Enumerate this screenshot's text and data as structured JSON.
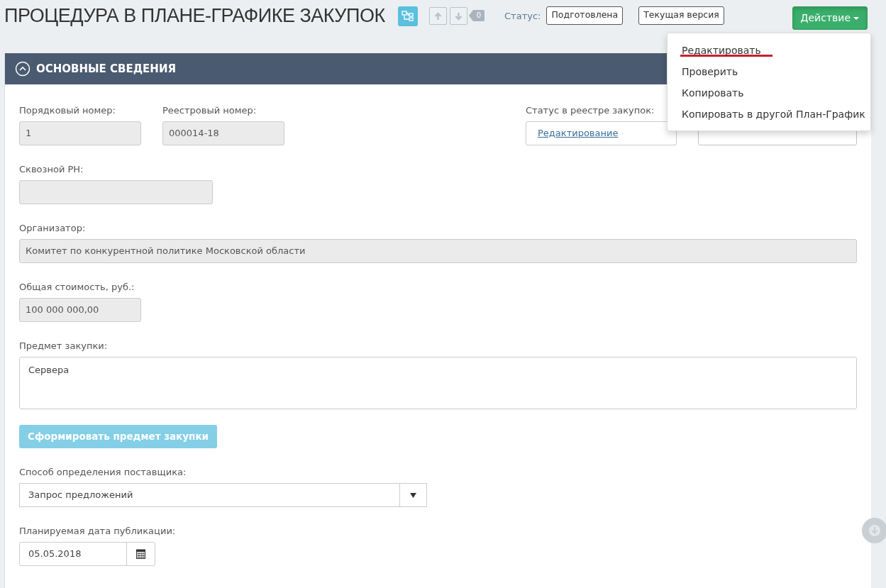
{
  "title": "ПРОЦЕДУРА В ПЛАНЕ-ГРАФИКЕ ЗАКУПОК",
  "counter": "0",
  "status_label": "Статус:",
  "status_badges": [
    "Подготовлена",
    "Текущая версия"
  ],
  "action_button": {
    "label": "Действие",
    "expanded": true
  },
  "action_menu": [
    {
      "label": "Редактировать",
      "underlined": true
    },
    {
      "label": "Проверить",
      "underlined": false
    },
    {
      "label": "Копировать",
      "underlined": false
    },
    {
      "label": "Копировать в другой План-График",
      "underlined": false
    }
  ],
  "section": {
    "title": "ОСНОВНЫЕ СВЕДЕНИЯ",
    "expanded": true
  },
  "form_rows": [
    [
      {
        "kind": "text",
        "label": "Порядковый номер:",
        "value": "1",
        "disabled": true
      },
      {
        "kind": "text",
        "label": "Реестровый номер:",
        "value": "000014-18",
        "disabled": true
      },
      {
        "kind": "spacer"
      },
      {
        "kind": "link",
        "label": "Статус в реестре закупок:",
        "value": "Редактирование"
      },
      {
        "kind": "text",
        "disabled": false
      }
    ],
    [
      {
        "kind": "text",
        "label": "Сквозной РН:",
        "disabled": true
      }
    ],
    [
      {
        "kind": "text",
        "label": "Организатор:",
        "value": "Комитет по конкурентной политике Московской области",
        "disabled": true
      }
    ],
    [
      {
        "kind": "text",
        "label": "Общая стоимость, руб.:",
        "value": "100 000 000,00",
        "disabled": true
      }
    ],
    [
      {
        "kind": "textarea",
        "label": "Предмет закупки:",
        "value": "Сервера"
      }
    ],
    [
      {
        "kind": "button",
        "value": "Сформировать предмет закупки",
        "disabled": true
      }
    ],
    [
      {
        "kind": "select",
        "label": "Способ определения поставщика:",
        "value": "Запрос предложений"
      }
    ],
    [
      {
        "kind": "date",
        "label": "Планируемая дата публикации:",
        "value": "05.05.2018"
      }
    ]
  ]
}
